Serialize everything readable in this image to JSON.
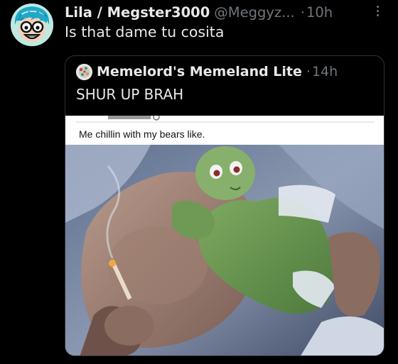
{
  "tweet": {
    "display_name": "Lila / Megster3000",
    "handle": "@Meggyz...",
    "separator": "·",
    "time": "10h",
    "text": "Is that dame tu cosita",
    "avatar_icon": "profile-avatar",
    "more_icon": "more-vertical-icon"
  },
  "quote": {
    "display_name": "Memelord's Memeland Lite",
    "separator": "·",
    "time": "14h",
    "text": "SHUR UP BRAH",
    "avatar_icon": "profile-avatar",
    "media": {
      "caption": "Me chillin with my  bears like."
    }
  },
  "colors": {
    "background": "#000000",
    "primary_text": "#e7e9ea",
    "secondary_text": "#71767b",
    "border": "#2f3336"
  }
}
